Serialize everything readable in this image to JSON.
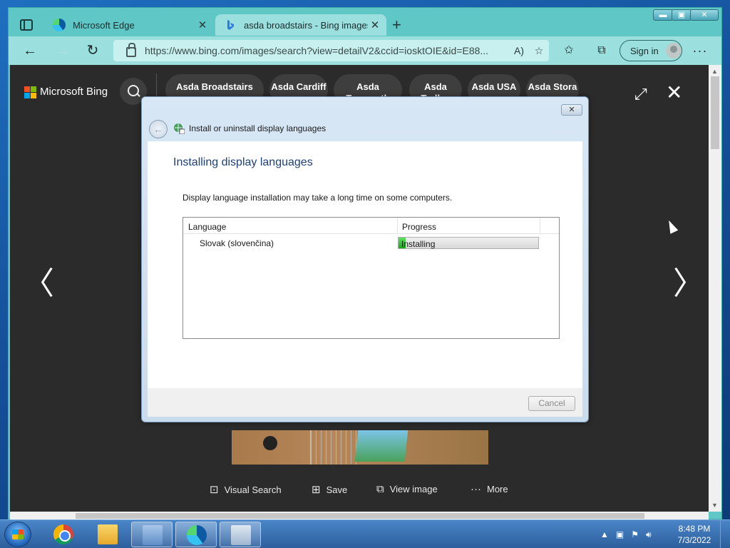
{
  "browser": {
    "tabs": [
      {
        "label": "Microsoft Edge",
        "close": "✕"
      },
      {
        "label": "asda broadstairs - Bing images",
        "close": "✕"
      }
    ],
    "new_tab": "+",
    "window_controls": {
      "minimize": "▬",
      "maximize": "▣",
      "close": "✕"
    },
    "url": "https://www.bing.com/images/search?view=detailV2&ccid=iosktOIE&id=E88...",
    "read_aloud": "A)",
    "signin_label": "Sign in",
    "menu": "···"
  },
  "bing": {
    "logo_text": "Microsoft Bing",
    "pills": [
      {
        "label": "Asda Broadstairs"
      },
      {
        "label": "Asda Cardiff"
      },
      {
        "label": "Asda Tamworth"
      },
      {
        "label": "Asda Tralley"
      },
      {
        "label": "Asda USA"
      },
      {
        "label": "Asda Stora"
      }
    ],
    "expand": "⤢",
    "close": "✕",
    "prev": "〈",
    "next": "〉",
    "actions": [
      {
        "icon": "⊡",
        "label": "Visual Search"
      },
      {
        "icon": "⊞",
        "label": "Save"
      },
      {
        "icon": "⧉",
        "label": "View image"
      },
      {
        "icon": "···",
        "label": "More"
      }
    ]
  },
  "dialog": {
    "close": "✕",
    "back": "←",
    "title": "Install or uninstall display languages",
    "heading": "Installing display languages",
    "description": "Display language installation may take a long time on some computers.",
    "table": {
      "col_language": "Language",
      "col_progress": "Progress",
      "rows": [
        {
          "language": "Slovak (slovenčina)",
          "status": "Installing",
          "progress_fraction": 0.05
        }
      ]
    },
    "cancel_label": "Cancel"
  },
  "taskbar": {
    "tray_up": "▲",
    "time": "8:48 PM",
    "date": "7/3/2022"
  },
  "colors": {
    "edge_frame": "#5fc8c6",
    "toolbar": "#9be0de",
    "dialog_heading": "#1e3f7a",
    "progress_fill": "#17a817"
  }
}
